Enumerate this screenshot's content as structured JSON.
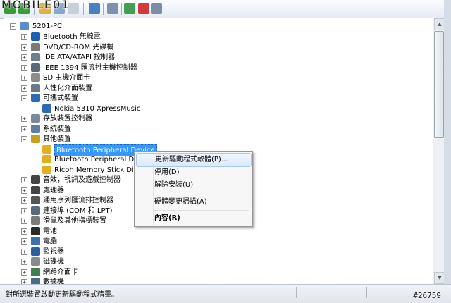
{
  "watermark": "MOBILE01",
  "root": "5201-PC",
  "tree": [
    {
      "label": "Bluetooth 無線電",
      "icon": "bluetooth-icon",
      "color": "#1c5fb0"
    },
    {
      "label": "DVD/CD-ROM 光碟機",
      "icon": "dvd-drive-icon",
      "color": "#7a7a7a"
    },
    {
      "label": "IDE ATA/ATAPI 控制器",
      "icon": "ide-controller-icon",
      "color": "#6f7f8f"
    },
    {
      "label": "IEEE 1394 匯流排主機控制器",
      "icon": "ieee1394-icon",
      "color": "#5a6a7a"
    },
    {
      "label": "SD 主機介面卡",
      "icon": "sd-card-icon",
      "color": "#8c8c8c"
    },
    {
      "label": "人性化介面裝置",
      "icon": "hid-icon",
      "color": "#6a7a8a"
    },
    {
      "label": "可攜式裝置",
      "icon": "portable-device-icon",
      "color": "#2d6bb5",
      "expanded": true
    },
    {
      "label": "Nokia 5310 XpressMusic",
      "icon": "phone-icon",
      "color": "#2d6bb5",
      "child": true
    },
    {
      "label": "存放裝置控制器",
      "icon": "storage-controller-icon",
      "color": "#7a8a9a"
    },
    {
      "label": "系統裝置",
      "icon": "system-device-icon",
      "color": "#5f7f9f"
    },
    {
      "label": "其他裝置",
      "icon": "other-devices-icon",
      "color": "#c8a020",
      "expanded": true
    },
    {
      "label": "Bluetooth Peripheral Device",
      "icon": "warning-device-icon",
      "color": "#e0b020",
      "child": true,
      "selected": true
    },
    {
      "label": "Bluetooth Peripheral Devi",
      "icon": "warning-device-icon",
      "color": "#e0b020",
      "child": true
    },
    {
      "label": "Ricoh Memory Stick Disk D",
      "icon": "warning-device-icon",
      "color": "#e0b020",
      "child": true
    },
    {
      "label": "音效，視訊及遊戲控制器",
      "icon": "speaker-icon",
      "color": "#444444"
    },
    {
      "label": "處理器",
      "icon": "processor-icon",
      "color": "#444444"
    },
    {
      "label": "通用序列匯流排控制器",
      "icon": "usb-icon",
      "color": "#555555"
    },
    {
      "label": "連接埠 (COM 和 LPT)",
      "icon": "port-icon",
      "color": "#5a6a7a"
    },
    {
      "label": "滑鼠及其他指標裝置",
      "icon": "mouse-icon",
      "color": "#7a7a7a"
    },
    {
      "label": "電池",
      "icon": "battery-icon",
      "color": "#2a2a2a"
    },
    {
      "label": "電腦",
      "icon": "computer-icon",
      "color": "#3a6fb0"
    },
    {
      "label": "監視器",
      "icon": "monitor-icon",
      "color": "#2a5fa0"
    },
    {
      "label": "磁碟機",
      "icon": "disk-drive-icon",
      "color": "#8a8a8a"
    },
    {
      "label": "網路介面卡",
      "icon": "network-adapter-icon",
      "color": "#3f7f4f"
    },
    {
      "label": "數據機",
      "icon": "modem-icon",
      "color": "#4a6a8a"
    }
  ],
  "context_menu": {
    "update_driver": "更新驅動程式軟體(P)...",
    "disable": "停用(D)",
    "uninstall": "解除安裝(U)",
    "scan": "硬體變更掃描(A)",
    "properties": "內容(R)"
  },
  "status": {
    "text": "對所選裝置啟動更新驅動程式精靈。",
    "tag": "#26759"
  }
}
